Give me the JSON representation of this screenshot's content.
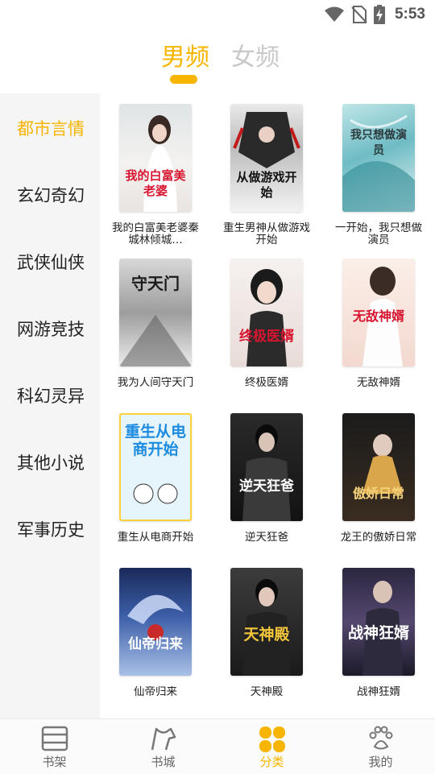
{
  "status": {
    "time": "5:53"
  },
  "tabs": {
    "male": "男频",
    "female": "女频"
  },
  "categories": [
    {
      "label": "都市言情"
    },
    {
      "label": "玄幻奇幻"
    },
    {
      "label": "武侠仙侠"
    },
    {
      "label": "网游竞技"
    },
    {
      "label": "科幻灵异"
    },
    {
      "label": "其他小说"
    },
    {
      "label": "军事历史"
    }
  ],
  "books": [
    {
      "title": "我的白富美老婆秦城林倾城…",
      "cover_text": "我的白富美老婆"
    },
    {
      "title": "重生男神从做游戏开始",
      "cover_text": "从做游戏开始"
    },
    {
      "title": "一开始，我只想做演员",
      "cover_text": "我只想做演员"
    },
    {
      "title": "我为人间守天门",
      "cover_text": "守天门"
    },
    {
      "title": "终极医婿",
      "cover_text": "终极医婿"
    },
    {
      "title": "无敌神婿",
      "cover_text": "无敌神婿"
    },
    {
      "title": "重生从电商开始",
      "cover_text": "重生从电商开始"
    },
    {
      "title": "逆天狂爸",
      "cover_text": "逆天狂爸"
    },
    {
      "title": "龙王的傲娇日常",
      "cover_text": "傲娇日常"
    },
    {
      "title": "仙帝归来",
      "cover_text": "仙帝归来"
    },
    {
      "title": "天神殿",
      "cover_text": "天神殿"
    },
    {
      "title": "战神狂婿",
      "cover_text": "战神狂婿"
    }
  ],
  "nav": {
    "bookshelf": "书架",
    "bookstore": "书城",
    "category": "分类",
    "mine": "我的"
  },
  "colors": {
    "accent": "#f7b500",
    "inactive": "#c8c8c8"
  }
}
